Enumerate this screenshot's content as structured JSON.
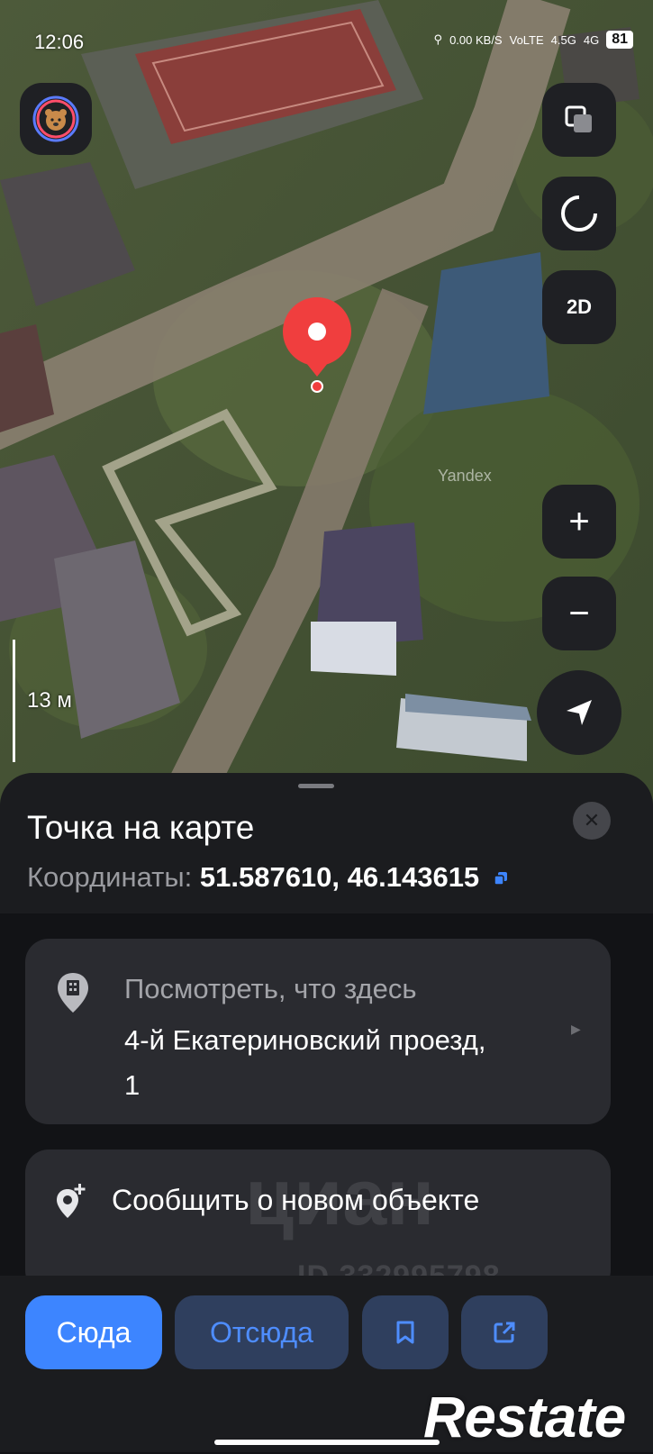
{
  "status_bar": {
    "time": "12:06",
    "network_speed": "0.00 KB/S",
    "volte": "VoLTE",
    "signal1": "4.5G",
    "signal2": "4G",
    "battery": "81"
  },
  "map": {
    "mode_button": "2D",
    "zoom_in": "+",
    "zoom_out": "−",
    "scale_label": "13 м",
    "provider_watermark": "Yandex"
  },
  "sheet": {
    "title": "Точка на карте",
    "coordinates_label": "Координаты:",
    "coordinates_value": "51.587610, 46.143615",
    "look_card": {
      "label": "Посмотреть, что здесь",
      "address": "4-й Екатериновский проезд, 1"
    },
    "report_card": {
      "label": "Сообщить о новом объекте"
    },
    "actions": {
      "to_here": "Сюда",
      "from_here": "Отсюда"
    }
  },
  "watermarks": {
    "cian": "циан",
    "cian_id": "ID 332995798",
    "restate": "Restate"
  },
  "colors": {
    "accent": "#3d85ff",
    "pin": "#f03e3e",
    "sheet_bg": "#1b1c1f",
    "card_bg": "#2a2b30"
  }
}
